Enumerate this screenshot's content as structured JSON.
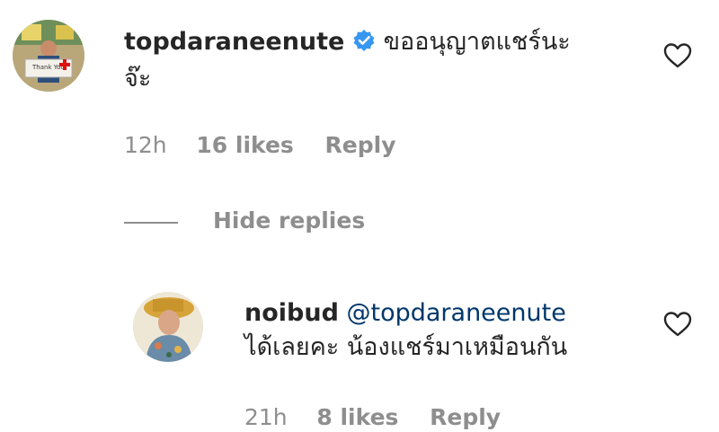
{
  "comment": {
    "username": "topdaraneenute",
    "verified": true,
    "text_line1": "ขออนุญาตแชร์นะ",
    "text_line2": "จ๊ะ",
    "time": "12h",
    "likes": "16 likes",
    "reply_label": "Reply",
    "avatar_sign_text": "Thank You"
  },
  "hide_replies_label": "Hide replies",
  "reply": {
    "username": "noibud",
    "mention": "@topdaraneenute",
    "text": "ได้เลยคะ น้องแชร์มาเหมือนกัน",
    "time": "21h",
    "likes": "8 likes",
    "reply_label": "Reply"
  },
  "colors": {
    "text": "#262626",
    "muted": "#8e8e8e",
    "verified": "#3897f0",
    "mention": "#00376b"
  }
}
